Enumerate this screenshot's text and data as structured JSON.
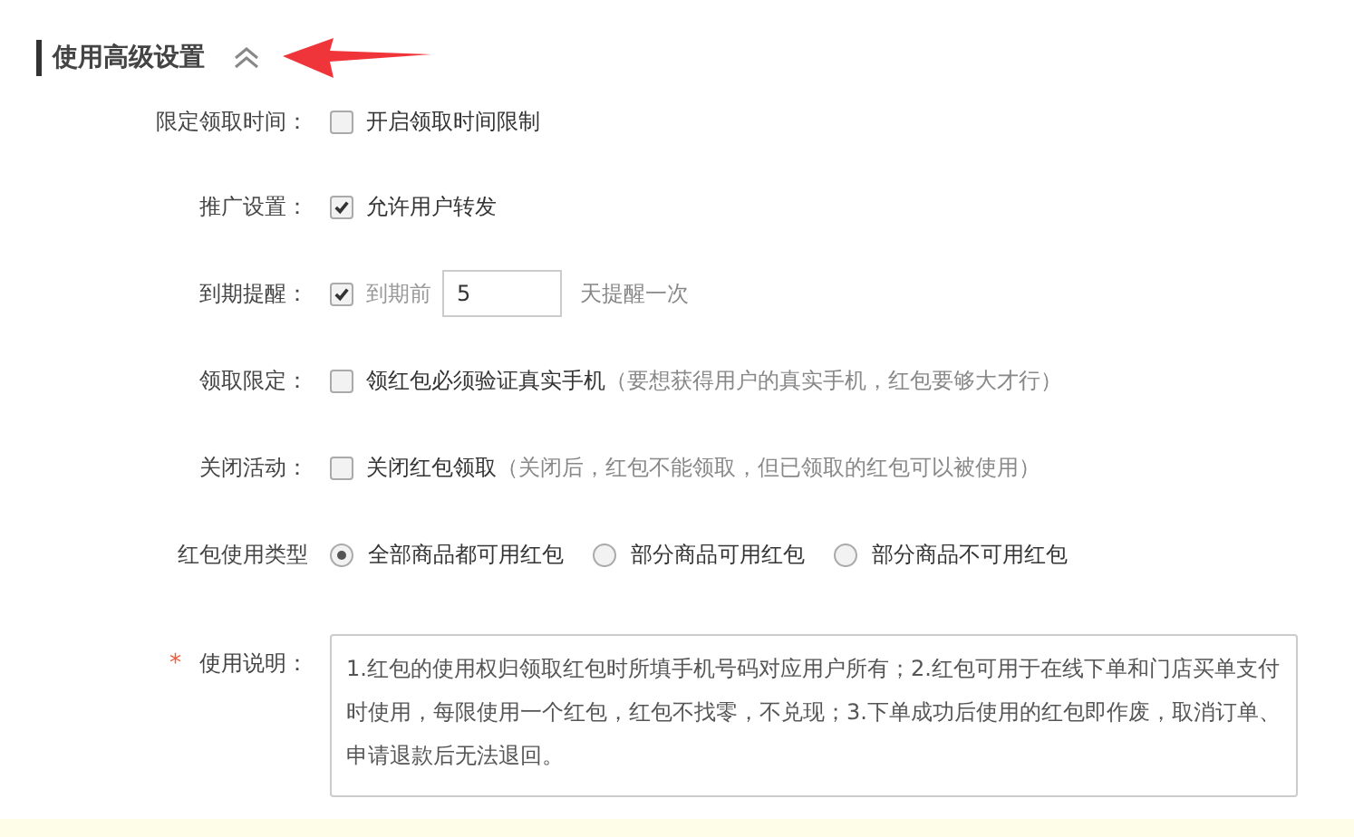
{
  "section": {
    "title": "使用高级设置",
    "expanded": true
  },
  "rows": [
    {
      "kind": "checkbox",
      "label": "限定领取时间：",
      "option": "开启领取时间限制",
      "checked": false
    },
    {
      "kind": "checkbox",
      "label": "推广设置：",
      "option": "允许用户转发",
      "checked": true
    },
    {
      "kind": "checkbox-input",
      "label": "到期提醒：",
      "option": "到期前",
      "value": "5",
      "suffix": "天提醒一次",
      "checked": true
    },
    {
      "kind": "checkbox",
      "label": "领取限定：",
      "option": "领红包必须验证真实手机",
      "note": "（要想获得用户的真实手机，红包要够大才行）",
      "checked": false
    },
    {
      "kind": "checkbox",
      "label": "关闭活动：",
      "option": "关闭红包领取",
      "note": "（关闭后，红包不能领取，但已领取的红包可以被使用）",
      "checked": false
    },
    {
      "kind": "radio",
      "label": "红包使用类型",
      "options": [
        {
          "label": "全部商品都可用红包",
          "selected": true
        },
        {
          "label": "部分商品可用红包",
          "selected": false
        },
        {
          "label": "部分商品不可用红包",
          "selected": false
        }
      ]
    },
    {
      "kind": "textarea",
      "label": "使用说明：",
      "required": true,
      "required_mark": "*",
      "value": "1.红包的使用权归领取红包时所填手机号码对应用户所有；2.红包可用于在线下单和门店买单支付时使用，每限使用一个红包，红包不找零，不兑现；3.下单成功后使用的红包即作废，取消订单、申请退款后无法退回。"
    }
  ]
}
